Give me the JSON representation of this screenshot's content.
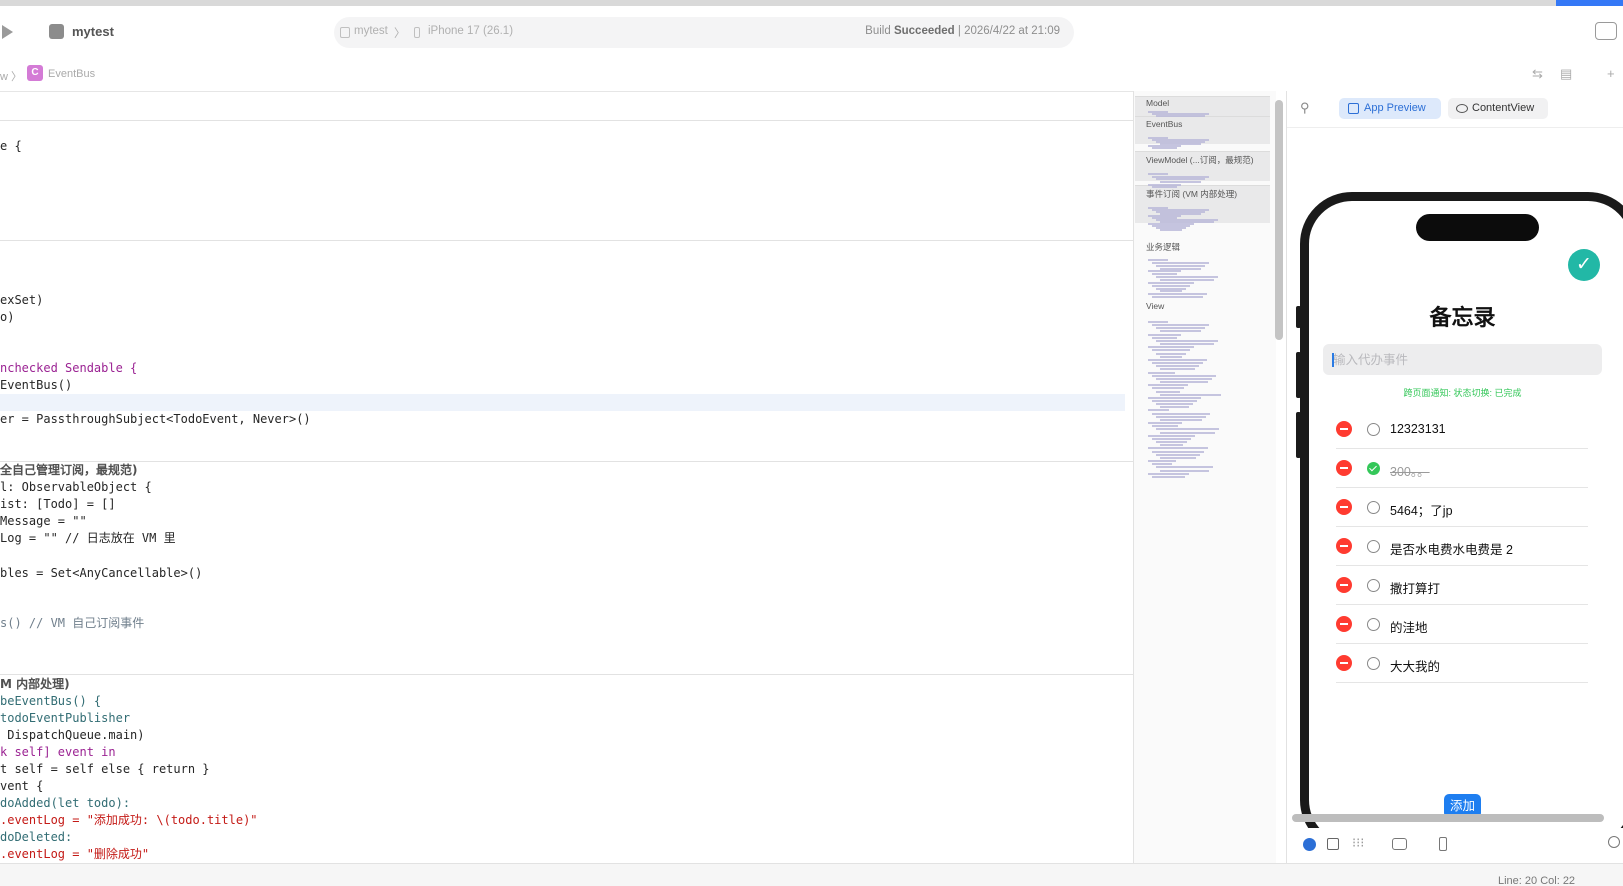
{
  "toolbar": {
    "project_name": "mytest",
    "scheme": "mytest",
    "scheme_separator": "〉",
    "device": "iPhone 17 (26.1)",
    "build_status_prefix": "Build",
    "build_status_bold": "Succeeded",
    "build_status_suffix": "| 2026/4/22 at 21:09",
    "icons": [
      "run-icon",
      "app-icon",
      "sidebar-toggle-icon"
    ]
  },
  "jumpbar": {
    "prev": "w 〉",
    "badge": "C",
    "current": "EventBus",
    "right_icons": [
      "⇆",
      "▤",
      "+"
    ]
  },
  "code_lines": [
    {
      "t": "e {"
    },
    {
      "t": "exSet)"
    },
    {
      "t": "o)"
    },
    {
      "t": "nchecked Sendable {"
    },
    {
      "t": "EventBus()"
    },
    {
      "t": "er = PassthroughSubject<TodoEvent, Never>()"
    },
    {
      "t": "全自己管理订阅，最规范)"
    },
    {
      "t": "l: ObservableObject {"
    },
    {
      "t": "ist: [Todo] = []"
    },
    {
      "t": "Message = \"\""
    },
    {
      "t": "Log = \"\" // 日志放在 VM 里"
    },
    {
      "t": "bles = Set<AnyCancellable>()"
    },
    {
      "t": "s() // VM 自己订阅事件"
    },
    {
      "t": "M 内部处理)"
    },
    {
      "t": "beEventBus() {"
    },
    {
      "t": "todoEventPublisher"
    },
    {
      "t": " DispatchQueue.main)"
    },
    {
      "t": "k self] event in"
    },
    {
      "t": "t self = self else { return }"
    },
    {
      "t": "vent {"
    },
    {
      "t": "doAdded(let todo):"
    },
    {
      "t": ".eventLog = \"添加成功: \\(todo.title)\""
    },
    {
      "t": "doDeleted:"
    },
    {
      "t": ".eventLog = \"删除成功\""
    }
  ],
  "minimap": {
    "sections": [
      "Model",
      "EventBus",
      "ViewModel (...订阅，最规范)",
      "事件订阅 (VM 内部处理)",
      "业务逻辑",
      "View"
    ]
  },
  "preview": {
    "tab_app_preview": "App Preview",
    "tab_content_view": "ContentView",
    "app": {
      "title": "备忘录",
      "input_placeholder": "输入代办事件",
      "input_value": "",
      "notice": "跨页面通知: 状态切换: 已完成",
      "add_button": "添加",
      "todos": [
        {
          "title": "12323131",
          "done": false
        },
        {
          "title": "300。。",
          "done": true
        },
        {
          "title": "5464；了jp",
          "done": false
        },
        {
          "title": "是否水电费水电费是 2",
          "done": false
        },
        {
          "title": "撒打算打",
          "done": false
        },
        {
          "title": "的洼地",
          "done": false
        },
        {
          "title": "大大我的",
          "done": false
        }
      ]
    },
    "bottom_icons": [
      "live-preview-icon",
      "select-icon",
      "grid-icon",
      "variants-icon",
      "device-icon",
      "zoom-icon"
    ]
  },
  "statusbar": {
    "line_col": "Line: 20  Col: 22"
  },
  "colors": {
    "accent_blue": "#2c6fd6",
    "delete_red": "#ff3b30",
    "done_green": "#34c759",
    "check_teal": "#22b8a6"
  }
}
